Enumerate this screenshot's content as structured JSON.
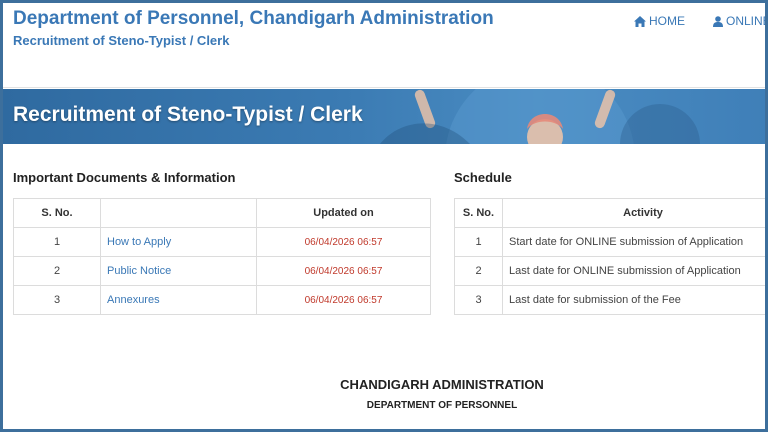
{
  "header": {
    "title": "Department of Personnel, Chandigarh Administration",
    "subtitle": "Recruitment of Steno-Typist / Clerk"
  },
  "nav": {
    "items": [
      {
        "label": "HOME",
        "icon": "home-icon"
      },
      {
        "label": "ONLINE R",
        "icon": "user-icon"
      }
    ]
  },
  "banner": {
    "title": "Recruitment of Steno-Typist / Clerk"
  },
  "documents": {
    "heading": "Important Documents & Information",
    "columns": [
      "S. No.",
      "",
      "Updated on"
    ],
    "rows": [
      {
        "sno": "1",
        "name": "How to Apply",
        "updated": "06/04/2026 06:57"
      },
      {
        "sno": "2",
        "name": "Public Notice",
        "updated": "06/04/2026 06:57"
      },
      {
        "sno": "3",
        "name": "Annexures",
        "updated": "06/04/2026 06:57"
      }
    ]
  },
  "schedule": {
    "heading": "Schedule",
    "columns": [
      "S. No.",
      "Activity"
    ],
    "rows": [
      {
        "sno": "1",
        "activity": "Start date for ONLINE submission of Application"
      },
      {
        "sno": "2",
        "activity": "Last date for ONLINE submission of Application"
      },
      {
        "sno": "3",
        "activity": "Last date for submission of the Fee"
      }
    ]
  },
  "footer": {
    "title": "CHANDIGARH ADMINISTRATION",
    "subtitle": "DEPARTMENT OF PERSONNEL"
  },
  "colors": {
    "brand": "#3a78b6",
    "banner": "#3b7bb3",
    "date": "#c0392b",
    "frame": "#3d6f9c"
  }
}
